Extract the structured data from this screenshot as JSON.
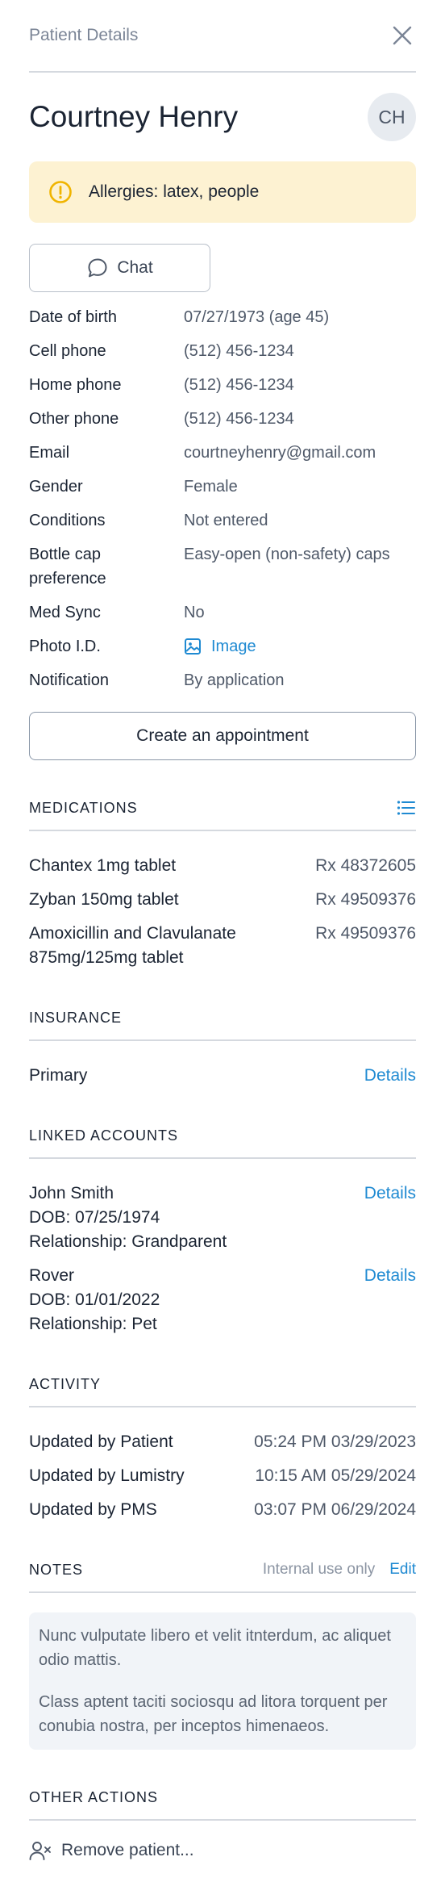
{
  "header": {
    "title": "Patient Details",
    "close_icon": "close-icon"
  },
  "patient": {
    "name": "Courtney Henry",
    "initials": "CH"
  },
  "alert": {
    "text": "Allergies: latex, people",
    "icon": "warning-circle-icon",
    "color": "#f0b400"
  },
  "chat_button": {
    "label": "Chat",
    "icon": "chat-bubble-icon"
  },
  "details": [
    {
      "key": "Date of birth",
      "value": "07/27/1973 (age 45)"
    },
    {
      "key": "Cell phone",
      "value": "(512) 456-1234"
    },
    {
      "key": "Home phone",
      "value": "(512) 456-1234"
    },
    {
      "key": "Other phone",
      "value": "(512) 456-1234"
    },
    {
      "key": "Email",
      "value": "courtneyhenry@gmail.com"
    },
    {
      "key": "Gender",
      "value": "Female"
    },
    {
      "key": "Conditions",
      "value": "Not entered"
    },
    {
      "key": "Bottle cap preference",
      "value": "Easy-open (non-safety) caps"
    },
    {
      "key": "Med Sync",
      "value": "No"
    },
    {
      "key": "Photo I.D.",
      "value": "Image",
      "icon": "image-icon"
    },
    {
      "key": "Notification",
      "value": "By application"
    }
  ],
  "appointment_button": {
    "label": "Create an appointment"
  },
  "medications": {
    "title": "MEDICATIONS",
    "icon": "list-icon",
    "items": [
      {
        "name": "Chantex 1mg tablet",
        "rx": "Rx 48372605"
      },
      {
        "name": "Zyban 150mg tablet",
        "rx": "Rx 49509376"
      },
      {
        "name": "Amoxicillin and Clavulanate 875mg/125mg tablet",
        "rx": "Rx 49509376"
      }
    ]
  },
  "insurance": {
    "title": "INSURANCE",
    "items": [
      {
        "label": "Primary",
        "action": "Details"
      }
    ]
  },
  "linked_accounts": {
    "title": "LINKED ACCOUNTS",
    "items": [
      {
        "name": "John Smith",
        "dob": "DOB: 07/25/1974",
        "relationship": "Relationship: Grandparent",
        "action": "Details"
      },
      {
        "name": "Rover",
        "dob": "DOB: 01/01/2022",
        "relationship": "Relationship: Pet",
        "action": "Details"
      }
    ]
  },
  "activity": {
    "title": "ACTIVITY",
    "items": [
      {
        "label": "Updated by Patient",
        "time": "05:24 PM 03/29/2023"
      },
      {
        "label": "Updated by Lumistry",
        "time": "10:15 AM 05/29/2024"
      },
      {
        "label": "Updated by PMS",
        "time": "03:07 PM 06/29/2024"
      }
    ]
  },
  "notes": {
    "title": "NOTES",
    "hint": "Internal use only",
    "edit": "Edit",
    "paragraphs": [
      "Nunc vulputate libero et velit itnterdum, ac aliquet odio mattis.",
      "Class aptent taciti sociosqu ad litora torquent per conubia nostra, per inceptos himenaeos."
    ]
  },
  "other_actions": {
    "title": "OTHER ACTIONS",
    "remove_label": "Remove patient...",
    "remove_icon": "remove-user-icon"
  },
  "colors": {
    "accent": "#1f8ad2",
    "alert_bg": "#fdf2d2",
    "divider": "#d5d9df"
  }
}
